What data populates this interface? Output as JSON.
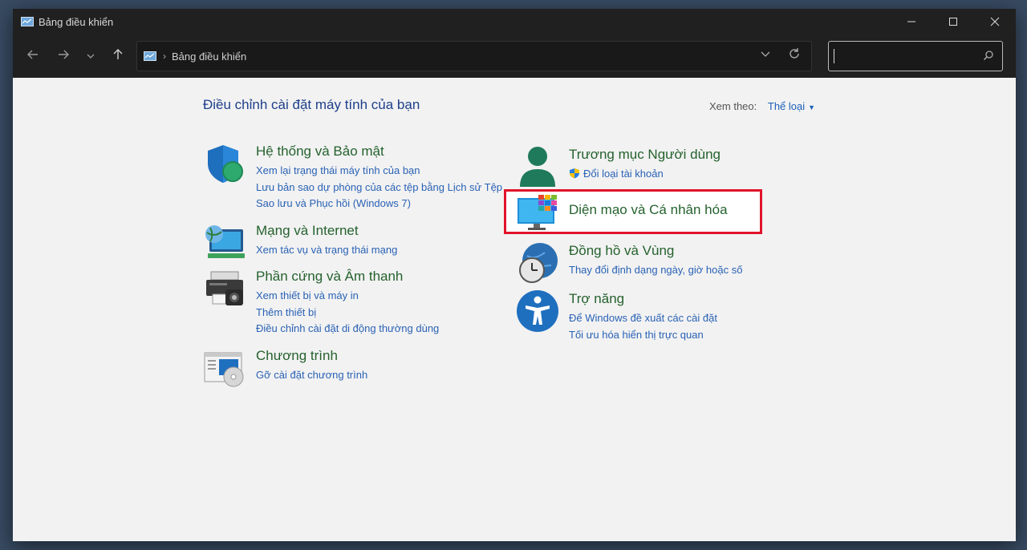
{
  "window": {
    "title": "Bảng điều khiển"
  },
  "address_bar": {
    "crumb": "Bảng điều khiển",
    "search_placeholder": ""
  },
  "main": {
    "heading": "Điều chỉnh cài đặt máy tính của bạn",
    "view_by_label": "Xem theo:",
    "view_by_value": "Thể loại",
    "left_categories": [
      {
        "title": "Hệ thống và Bảo mật",
        "icon": "shield-icon",
        "links": [
          "Xem lại trạng thái máy tính của bạn",
          "Lưu bản sao dự phòng của các tệp bằng Lịch sử Tệp",
          "Sao lưu và Phục hồi (Windows 7)"
        ]
      },
      {
        "title": "Mạng và Internet",
        "icon": "network-icon",
        "links": [
          "Xem tác vụ và trạng thái mạng"
        ]
      },
      {
        "title": "Phần cứng và Âm thanh",
        "icon": "printer-icon",
        "links": [
          "Xem thiết bị và máy in",
          "Thêm thiết bị",
          "Điều chỉnh cài đặt di động thường dùng"
        ]
      },
      {
        "title": "Chương trình",
        "icon": "programs-icon",
        "links": [
          "Gỡ cài đặt chương trình"
        ]
      }
    ],
    "right_categories": [
      {
        "title": "Trương mục Người dùng",
        "icon": "user-icon",
        "links": [
          "Đổi loại tài khoản"
        ]
      },
      {
        "title": "Diện mạo và Cá nhân hóa",
        "icon": "monitor-icon",
        "links": []
      },
      {
        "title": "Đồng hồ và Vùng",
        "icon": "clock-icon",
        "links": [
          "Thay đổi định dạng ngày, giờ hoặc số"
        ]
      },
      {
        "title": "Trợ năng",
        "icon": "accessibility-icon",
        "links": [
          "Để Windows đề xuất các cài đặt",
          "Tối ưu hóa hiển thị trực quan"
        ]
      }
    ]
  },
  "colors": {
    "highlight": "#e0142a",
    "category_title": "#25622e",
    "link": "#2a62b5",
    "heading": "#1e3f8a"
  }
}
